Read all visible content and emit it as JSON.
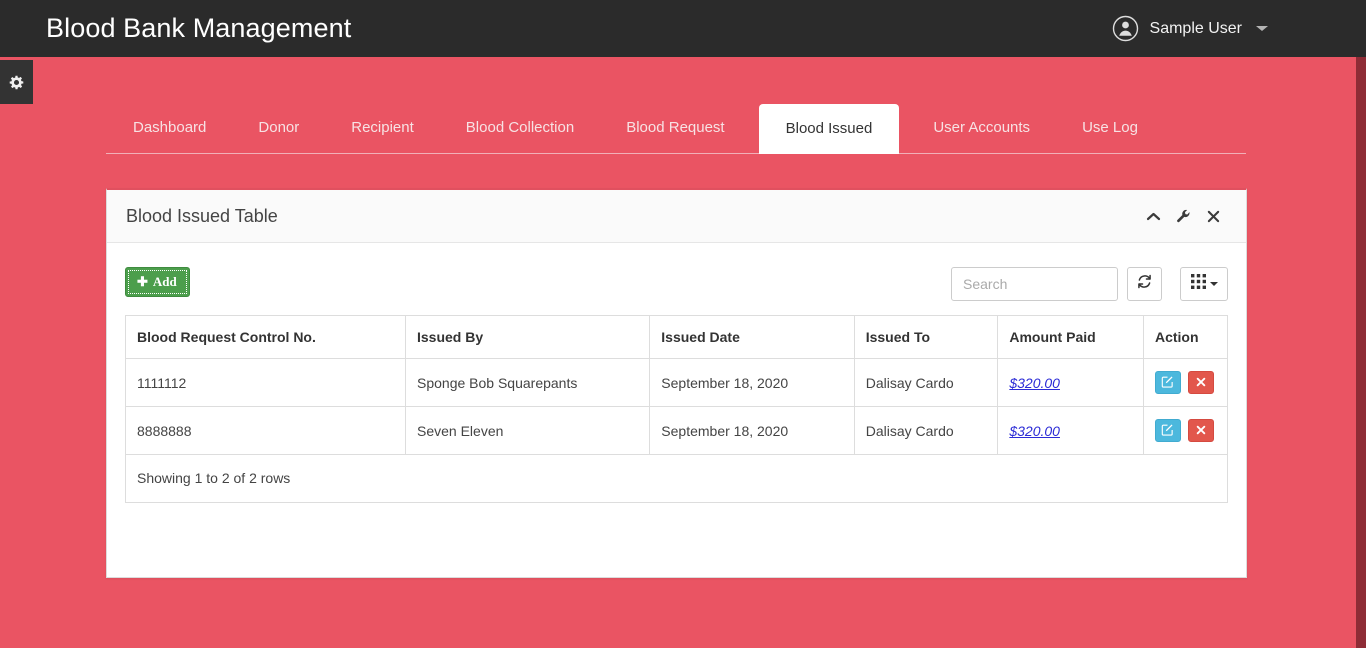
{
  "navbar": {
    "brand": "Blood Bank Management",
    "user_name": "Sample User",
    "user_icon": "user-circle-icon",
    "caret_icon": "chevron-down-icon"
  },
  "sidebar_toggle": {
    "icon": "gear-icon"
  },
  "tabs": [
    {
      "label": "Dashboard",
      "active": false
    },
    {
      "label": "Donor",
      "active": false
    },
    {
      "label": "Recipient",
      "active": false
    },
    {
      "label": "Blood Collection",
      "active": false
    },
    {
      "label": "Blood Request",
      "active": false
    },
    {
      "label": "Blood Issued",
      "active": true
    },
    {
      "label": "User Accounts",
      "active": false
    },
    {
      "label": "Use Log",
      "active": false
    }
  ],
  "panel": {
    "title": "Blood Issued Table",
    "tools": [
      {
        "name": "collapse-icon",
        "glyph": "chevron-up"
      },
      {
        "name": "wrench-icon",
        "glyph": "wrench"
      },
      {
        "name": "close-icon",
        "glyph": "times"
      }
    ]
  },
  "toolbar": {
    "add_label": "Add",
    "add_icon": "plus-icon",
    "search_placeholder": "Search",
    "search_value": "",
    "refresh_icon": "refresh-icon",
    "columns_icon": "grid-icon"
  },
  "table": {
    "columns": [
      "Blood Request Control No.",
      "Issued By",
      "Issued Date",
      "Issued To",
      "Amount Paid",
      "Action"
    ],
    "rows": [
      {
        "control_no": "1111112",
        "issued_by": "Sponge Bob Squarepants",
        "issued_date": "September 18, 2020",
        "issued_to": "Dalisay Cardo",
        "amount_paid": "$320.00"
      },
      {
        "control_no": "8888888",
        "issued_by": "Seven Eleven",
        "issued_date": "September 18, 2020",
        "issued_to": "Dalisay Cardo",
        "amount_paid": "$320.00"
      }
    ],
    "footer": "Showing 1 to 2 of 2 rows",
    "row_actions": [
      {
        "name": "edit-row-button",
        "icon": "pencil-square-icon"
      },
      {
        "name": "delete-row-button",
        "icon": "times-icon"
      }
    ]
  },
  "colors": {
    "page_background": "#ea5463",
    "navbar_background": "#2b2b2b",
    "panel_accent": "#e0505f",
    "add_button": "#4c9e4c",
    "edit_button": "#4cb8dd",
    "delete_button": "#e2574c",
    "link": "#2b2bd6"
  }
}
